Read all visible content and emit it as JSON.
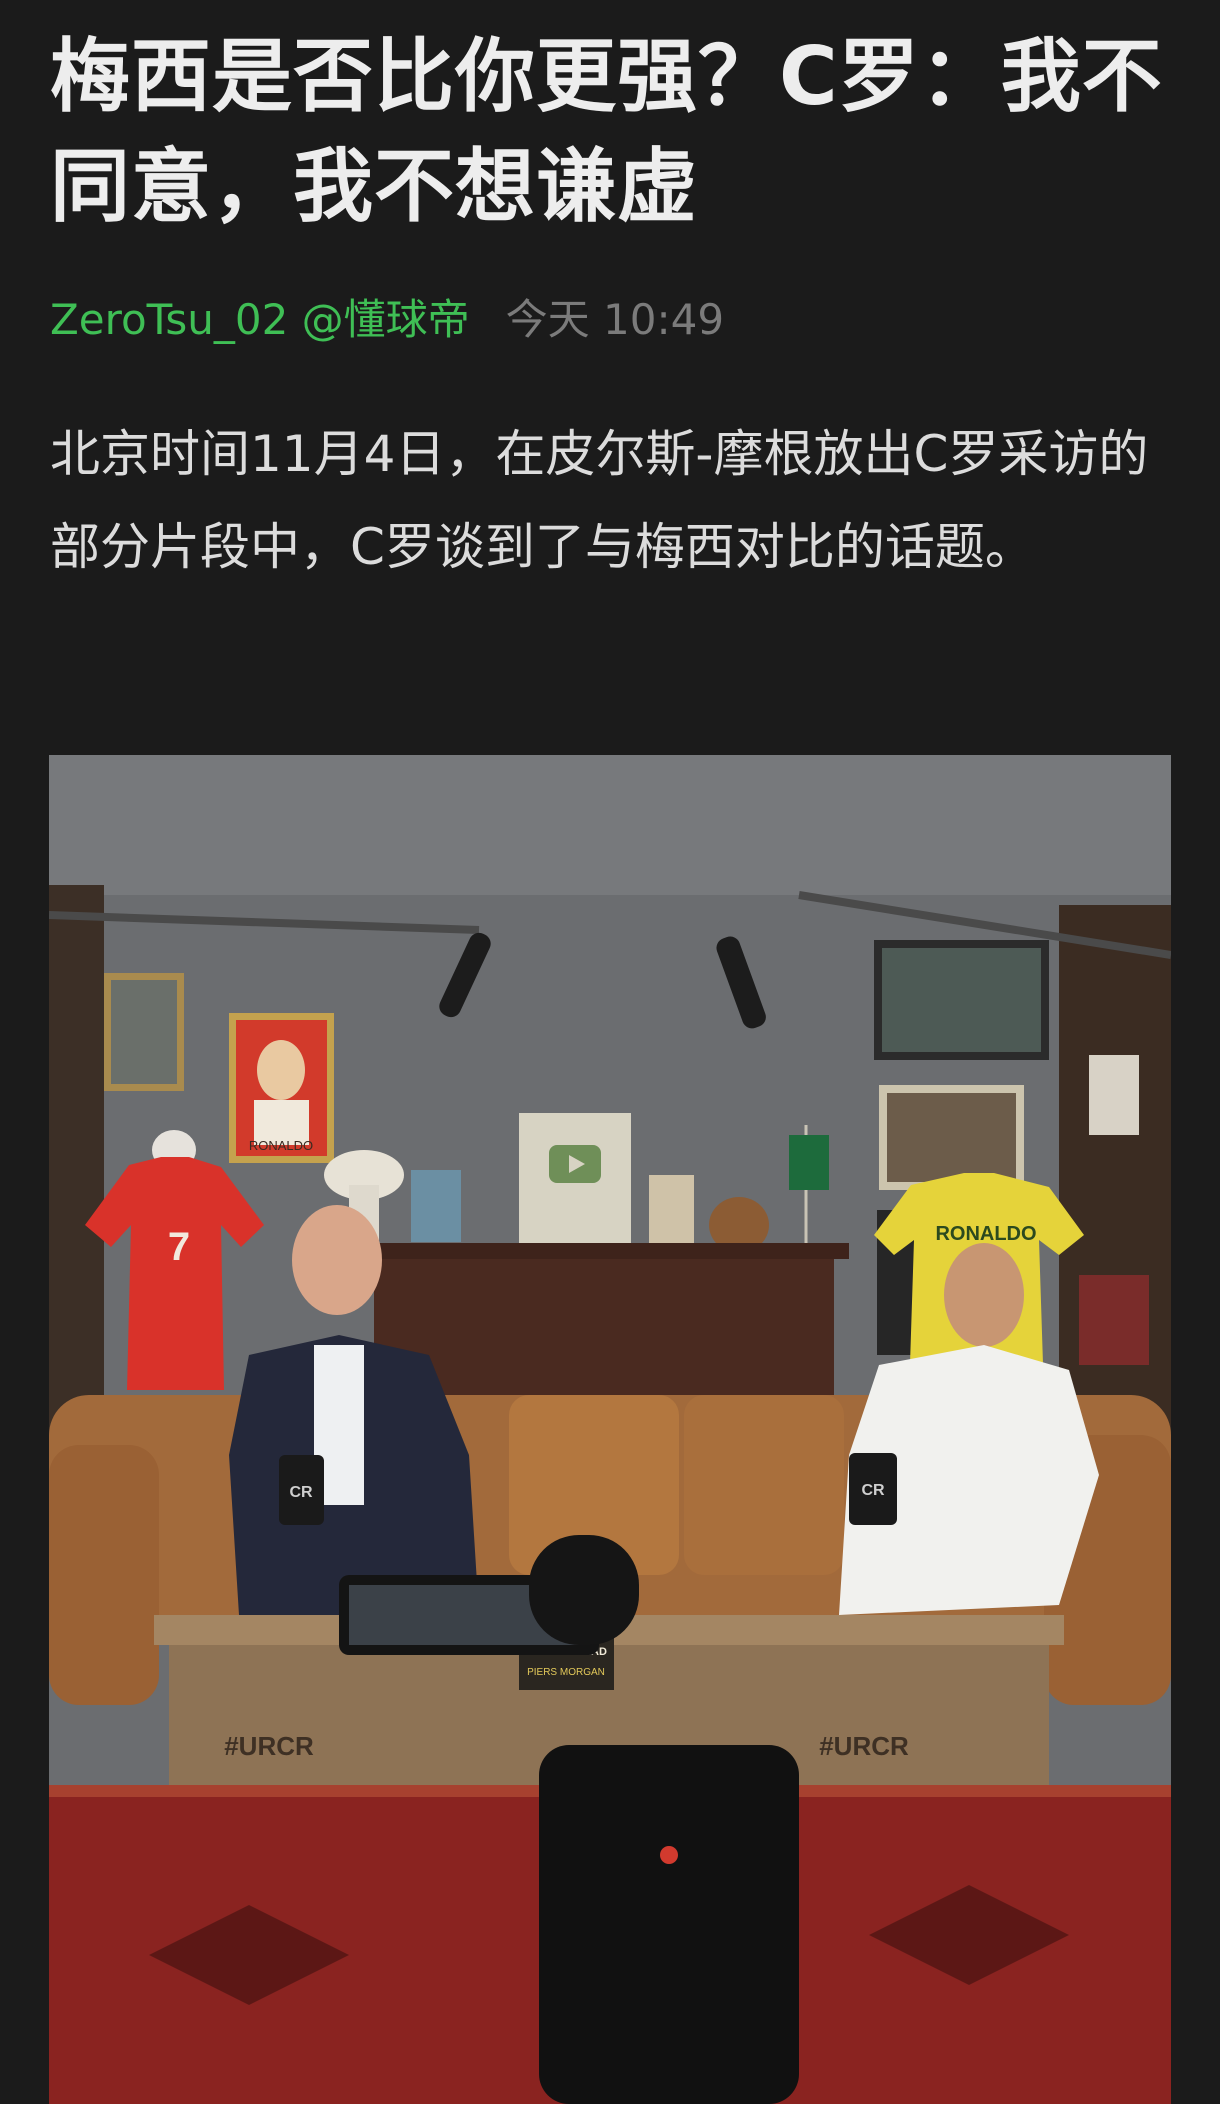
{
  "article": {
    "title": "梅西是否比你更强？C罗：我不同意，我不想谦虚",
    "author": "ZeroTsu_02 @懂球帝",
    "time": "今天 10:49",
    "body": "北京时间11月4日，在皮尔斯-摩根放出C罗采访的部分片段中，C罗谈到了与梅西对比的话题。"
  },
  "photo": {
    "jersey_left_number": "7",
    "poster_label": "RONALDO",
    "jersey_right_label": "RONALDO",
    "table_tag_left": "#URCR",
    "table_tag_right": "#URCR",
    "book_title": "WOKE IS DEAD",
    "book_author": "PIERS MORGAN",
    "mic_logo": "CR"
  },
  "colors": {
    "background": "#1b1b1b",
    "author": "#3fbf55",
    "time": "#7b7b7b"
  }
}
